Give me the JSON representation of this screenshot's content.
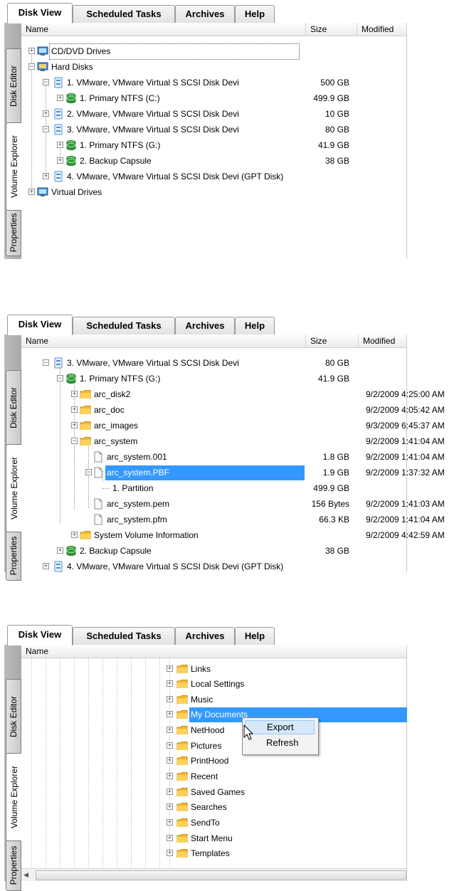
{
  "tabs": [
    "Disk View",
    "Scheduled Tasks",
    "Archives",
    "Help"
  ],
  "side_tabs": [
    "Disk Editor",
    "Volume Explorer",
    "Properties"
  ],
  "columns": {
    "name": "Name",
    "size": "Size",
    "modified": "Modified"
  },
  "panel1": {
    "rows": [
      {
        "label": "CD/DVD Drives",
        "size": "",
        "modified": ""
      },
      {
        "label": "Hard Disks",
        "size": "",
        "modified": ""
      },
      {
        "label": "1. VMware, VMware Virtual S SCSI Disk Devi",
        "size": "500 GB",
        "modified": ""
      },
      {
        "label": "1. Primary NTFS (C:)",
        "size": "499.9 GB",
        "modified": ""
      },
      {
        "label": "2. VMware, VMware Virtual S SCSI Disk Devi",
        "size": "10 GB",
        "modified": ""
      },
      {
        "label": "3. VMware, VMware Virtual S SCSI Disk Devi",
        "size": "80 GB",
        "modified": ""
      },
      {
        "label": "1. Primary NTFS (G:)",
        "size": "41.9 GB",
        "modified": ""
      },
      {
        "label": "2. Backup Capsule",
        "size": "38 GB",
        "modified": ""
      },
      {
        "label": "4. VMware, VMware Virtual S SCSI Disk Devi (GPT Disk)",
        "size": "",
        "modified": ""
      },
      {
        "label": "Virtual Drives",
        "size": "",
        "modified": ""
      }
    ]
  },
  "panel2": {
    "rows": [
      {
        "label": "3. VMware, VMware Virtual S SCSI Disk Devi",
        "size": "80 GB",
        "modified": ""
      },
      {
        "label": "1. Primary NTFS (G:)",
        "size": "41.9 GB",
        "modified": ""
      },
      {
        "label": "arc_disk2",
        "size": "",
        "modified": "9/2/2009 4:25:00 AM"
      },
      {
        "label": "arc_doc",
        "size": "",
        "modified": "9/2/2009 4:05:42 AM"
      },
      {
        "label": "arc_images",
        "size": "",
        "modified": "9/3/2009 6:45:37 AM"
      },
      {
        "label": "arc_system",
        "size": "",
        "modified": "9/2/2009 1:41:04 AM"
      },
      {
        "label": "arc_system.001",
        "size": "1.8 GB",
        "modified": "9/2/2009 1:41:04 AM"
      },
      {
        "label": "arc_system.PBF",
        "size": "1.9 GB",
        "modified": "9/2/2009 1:37:32 AM"
      },
      {
        "label": "1. Partition",
        "size": "499.9 GB",
        "modified": ""
      },
      {
        "label": "arc_system.pem",
        "size": "156 Bytes",
        "modified": "9/2/2009 1:41:03 AM"
      },
      {
        "label": "arc_system.pfm",
        "size": "66.3 KB",
        "modified": "9/2/2009 1:41:04 AM"
      },
      {
        "label": "System Volume Information",
        "size": "",
        "modified": "9/2/2009 4:42:59 AM"
      },
      {
        "label": "2. Backup Capsule",
        "size": "38 GB",
        "modified": ""
      },
      {
        "label": "4. VMware, VMware Virtual S SCSI Disk Devi (GPT Disk)",
        "size": "",
        "modified": ""
      }
    ]
  },
  "panel3": {
    "rows": [
      {
        "label": "Links"
      },
      {
        "label": "Local Settings"
      },
      {
        "label": "Music"
      },
      {
        "label": "My Documents"
      },
      {
        "label": "NetHood"
      },
      {
        "label": "Pictures"
      },
      {
        "label": "PrintHood"
      },
      {
        "label": "Recent"
      },
      {
        "label": "Saved Games"
      },
      {
        "label": "Searches"
      },
      {
        "label": "SendTo"
      },
      {
        "label": "Start Menu"
      },
      {
        "label": "Templates"
      }
    ],
    "context_menu": [
      "Export",
      "Refresh"
    ]
  },
  "colors": {
    "selection": "#3399ff",
    "folder": "#f5b82e",
    "disk_blue": "#4a90d9",
    "volume_green": "#2e9a3a"
  },
  "icons": {
    "drive_group": "monitor-drive-icon",
    "disk": "hard-disk-icon",
    "volume": "green-volume-icon",
    "folder": "folder-icon",
    "file": "file-icon"
  }
}
